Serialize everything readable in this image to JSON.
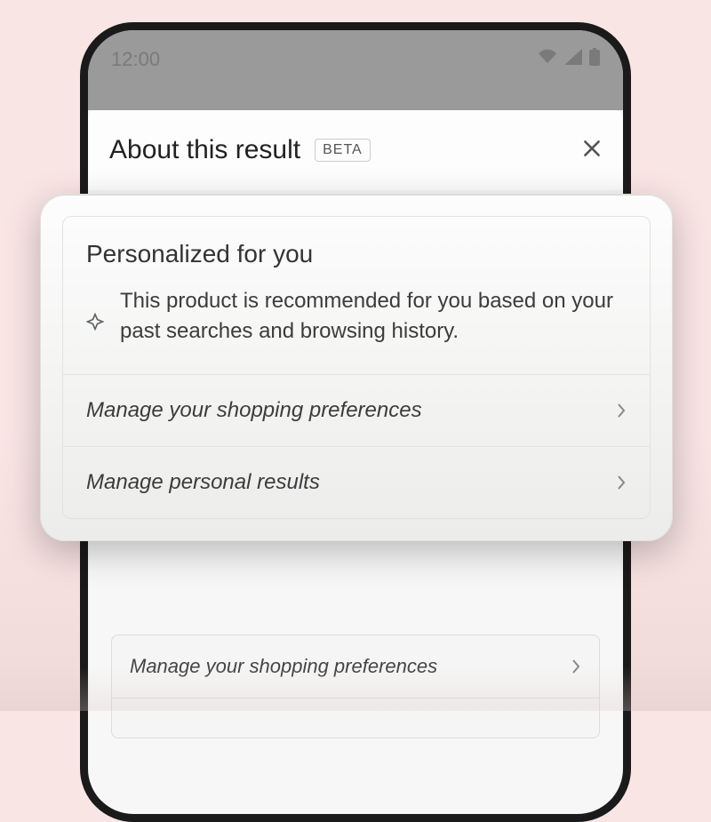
{
  "status": {
    "time": "12:00"
  },
  "panel": {
    "title": "About this result",
    "badge": "BETA"
  },
  "popup": {
    "heading": "Personalized for you",
    "body": "This product is recommended for you based on your past searches and browsing history.",
    "links": [
      "Manage your shopping preferences",
      "Manage personal results"
    ]
  },
  "background_links": [
    "Manage your shopping preferences"
  ]
}
